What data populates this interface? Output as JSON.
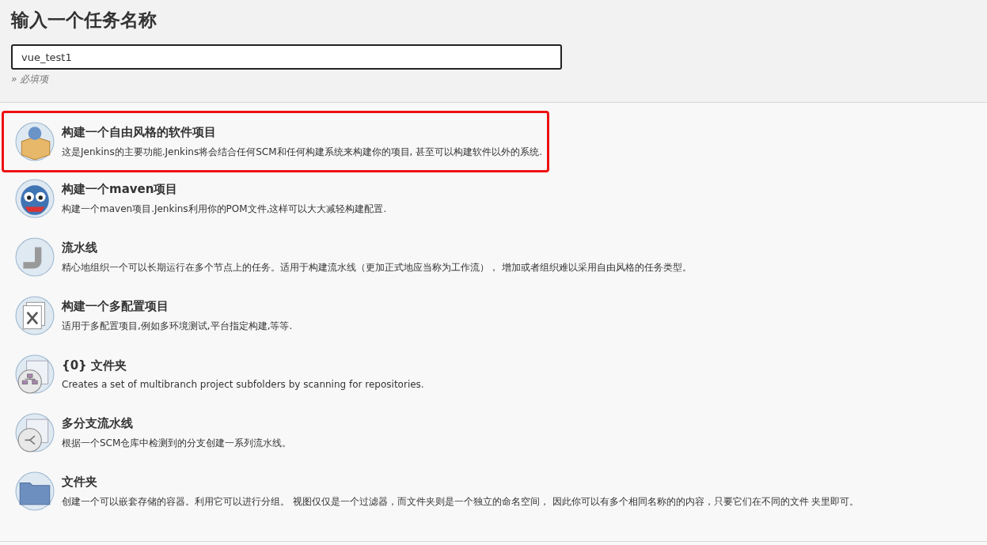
{
  "heading": "输入一个任务名称",
  "name_field": {
    "value": "vue_test1"
  },
  "required_hint": "» 必填项",
  "job_types": [
    {
      "kind": "freestyle",
      "title": "构建一个自由风格的软件项目",
      "description": "这是Jenkins的主要功能.Jenkins将会结合任何SCM和任何构建系统来构建你的项目, 甚至可以构建软件以外的系统.",
      "highlighted": true
    },
    {
      "kind": "maven",
      "title": "构建一个maven项目",
      "description": "构建一个maven项目.Jenkins利用你的POM文件,这样可以大大减轻构建配置.",
      "highlighted": false
    },
    {
      "kind": "pipeline",
      "title": "流水线",
      "description": "精心地组织一个可以长期运行在多个节点上的任务。适用于构建流水线（更加正式地应当称为工作流）， 增加或者组织难以采用自由风格的任务类型。",
      "highlighted": false
    },
    {
      "kind": "matrix",
      "title": "构建一个多配置项目",
      "description": "适用于多配置项目,例如多环境测试,平台指定构建,等等.",
      "highlighted": false
    },
    {
      "kind": "org-folder",
      "title": "{0} 文件夹",
      "description": "Creates a set of multibranch project subfolders by scanning for repositories.",
      "highlighted": false
    },
    {
      "kind": "multibranch",
      "title": "多分支流水线",
      "description": "根据一个SCM仓库中检测到的分支创建一系列流水线。",
      "highlighted": false
    },
    {
      "kind": "folder",
      "title": "文件夹",
      "description": "创建一个可以嵌套存储的容器。利用它可以进行分组。 视图仅仅是一个过滤器，而文件夹则是一个独立的命名空间， 因此你可以有多个相同名称的的内容，只要它们在不同的文件 夹里即可。",
      "highlighted": false
    }
  ]
}
